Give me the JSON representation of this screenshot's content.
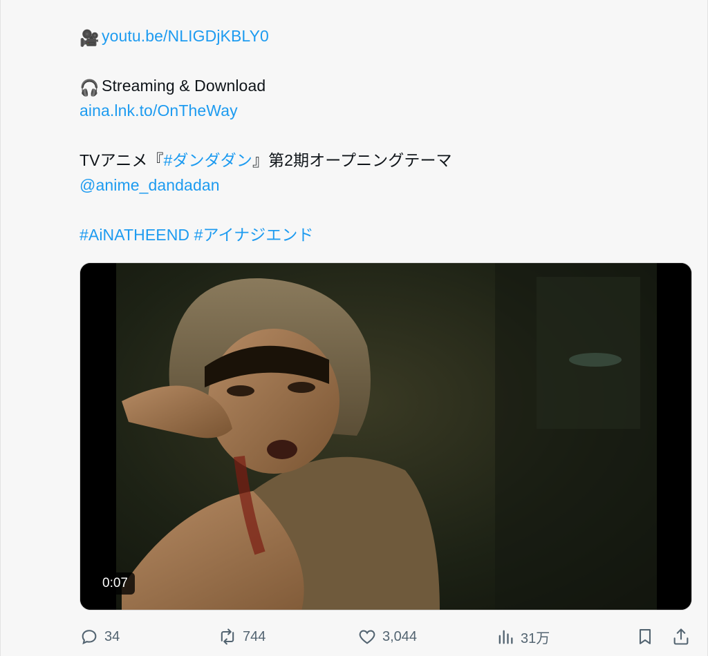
{
  "post": {
    "lines": [
      {
        "emoji": "🎥",
        "text": "youtu.be/NLIGDjKBLY0"
      },
      {
        "emoji": "🎧",
        "text": "Streaming & Download"
      },
      {
        "link": "aina.lnk.to/OnTheWay"
      },
      {
        "prefix": "TVアニメ『",
        "hashtag": "#ダンダダン",
        "suffix": "』第2期オープニングテーマ"
      },
      {
        "mention": "@anime_dandadan"
      },
      {
        "hashtags": "#AiNATHEEND #アイナジエンド"
      }
    ]
  },
  "video": {
    "timestamp": "0:07"
  },
  "actions": {
    "replies": "34",
    "reposts": "744",
    "likes": "3,044",
    "views": "31万"
  },
  "colors": {
    "link": "#1d9bf0",
    "icon": "#536471",
    "background": "#f7f7f7"
  },
  "icons": [
    "video-camera-emoji",
    "headphones-emoji",
    "reply-icon",
    "repost-icon",
    "like-icon",
    "views-icon",
    "bookmark-icon",
    "share-icon"
  ]
}
